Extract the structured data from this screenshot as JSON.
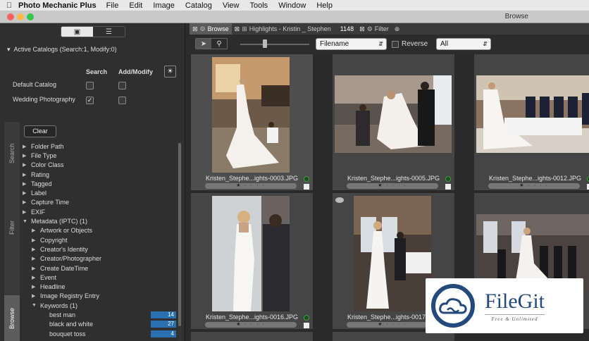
{
  "menubar": {
    "apple": "",
    "app_name": "Photo Mechanic Plus",
    "items": [
      "File",
      "Edit",
      "Image",
      "Catalog",
      "View",
      "Tools",
      "Window",
      "Help"
    ]
  },
  "window": {
    "title": "Browse"
  },
  "left_panel": {
    "catalogs_header": "Active Catalogs (Search:1, Modify:0)",
    "col_search": "Search",
    "col_add_modify": "Add/Modify",
    "catalogs": [
      {
        "name": "Default Catalog",
        "search": false,
        "modify": false
      },
      {
        "name": "Wedding Photography",
        "search": true,
        "modify": false
      }
    ],
    "side_tabs": [
      "Search",
      "Filter",
      "Browse"
    ],
    "clear_label": "Clear",
    "tree": [
      {
        "label": "Folder Path",
        "indent": 0,
        "open": false
      },
      {
        "label": "File Type",
        "indent": 0,
        "open": false
      },
      {
        "label": "Color Class",
        "indent": 0,
        "open": false
      },
      {
        "label": "Rating",
        "indent": 0,
        "open": false
      },
      {
        "label": "Tagged",
        "indent": 0,
        "open": false
      },
      {
        "label": "Label",
        "indent": 0,
        "open": false
      },
      {
        "label": "Capture Time",
        "indent": 0,
        "open": false
      },
      {
        "label": "EXIF",
        "indent": 0,
        "open": false
      },
      {
        "label": "Metadata (IPTC) (1)",
        "indent": 0,
        "open": true
      },
      {
        "label": "Artwork or Objects",
        "indent": 1,
        "open": false
      },
      {
        "label": "Copyright",
        "indent": 1,
        "open": false
      },
      {
        "label": "Creator's Identity",
        "indent": 1,
        "open": false
      },
      {
        "label": "Creator/Photographer",
        "indent": 1,
        "open": false
      },
      {
        "label": "Create DateTime",
        "indent": 1,
        "open": false
      },
      {
        "label": "Event",
        "indent": 1,
        "open": false
      },
      {
        "label": "Headline",
        "indent": 1,
        "open": false
      },
      {
        "label": "Image Registry Entry",
        "indent": 1,
        "open": false
      },
      {
        "label": "Keywords (1)",
        "indent": 1,
        "open": true
      },
      {
        "label": "best man",
        "indent": 2,
        "open": null,
        "count": "14"
      },
      {
        "label": "black and white",
        "indent": 2,
        "open": null,
        "count": "27"
      },
      {
        "label": "bouquet toss",
        "indent": 2,
        "open": null,
        "count": "4"
      }
    ]
  },
  "tabs": [
    {
      "label": "Browse",
      "active": true
    },
    {
      "label": "Highlights - Kristin _ Stephen",
      "active": false,
      "count": "1148"
    },
    {
      "label": "Filter",
      "active": false
    }
  ],
  "toolbar": {
    "sort": "Filename",
    "reverse_label": "Reverse",
    "reverse_checked": false,
    "filter": "All"
  },
  "thumbnails": [
    {
      "filename": "Kristen_Stephe...ights-0003.JPG",
      "selected": true
    },
    {
      "filename": "Kristen_Stephe...ights-0005.JPG",
      "selected": false
    },
    {
      "filename": "Kristen_Stephe...ights-0012.JPG",
      "selected": false
    },
    {
      "filename": "Kristen_Stephe...ights-0016.JPG",
      "selected": false
    },
    {
      "filename": "Kristen_Stephe...ights-0017.JPG",
      "selected": false
    },
    {
      "filename": "",
      "selected": false
    }
  ],
  "watermark": {
    "name": "FileGit",
    "tagline": "Free & Unlimited"
  },
  "colors": {
    "accent": "#2a6fb0",
    "watermark": "#24497d",
    "panel": "#2f2f2f",
    "cell": "#454545"
  }
}
